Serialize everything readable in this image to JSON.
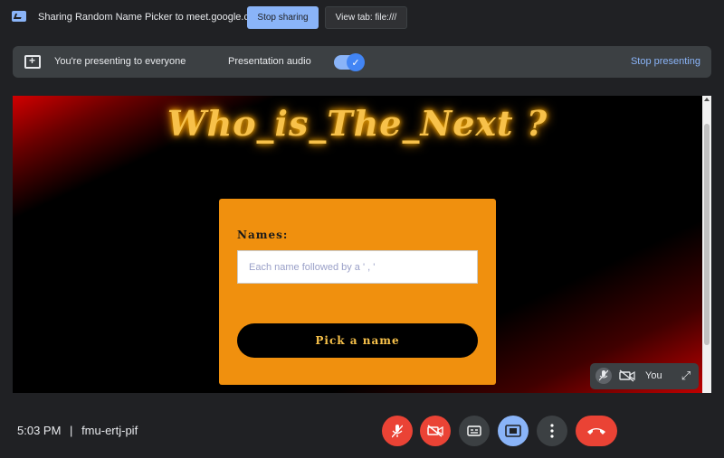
{
  "share_bar": {
    "message": "Sharing Random Name Picker to meet.google.com",
    "stop_label": "Stop sharing",
    "view_tab_label": "View tab: file:///"
  },
  "presenting": {
    "message": "You're presenting to everyone",
    "audio_label": "Presentation audio",
    "audio_enabled": true,
    "stop_label": "Stop presenting"
  },
  "page": {
    "title": "Who_is_The_Next ?",
    "names_label": "Names:",
    "names_placeholder": "Each name followed by a ' , '",
    "pick_button": "Pick a name"
  },
  "self_view": {
    "label": "You"
  },
  "meeting": {
    "time": "5:03 PM",
    "separator": "|",
    "code": "fmu-ertj-pif"
  },
  "colors": {
    "accent_blue": "#8ab4f8",
    "danger_red": "#ea4335",
    "card_orange": "#f0900e",
    "title_gold": "#f7c14a"
  }
}
